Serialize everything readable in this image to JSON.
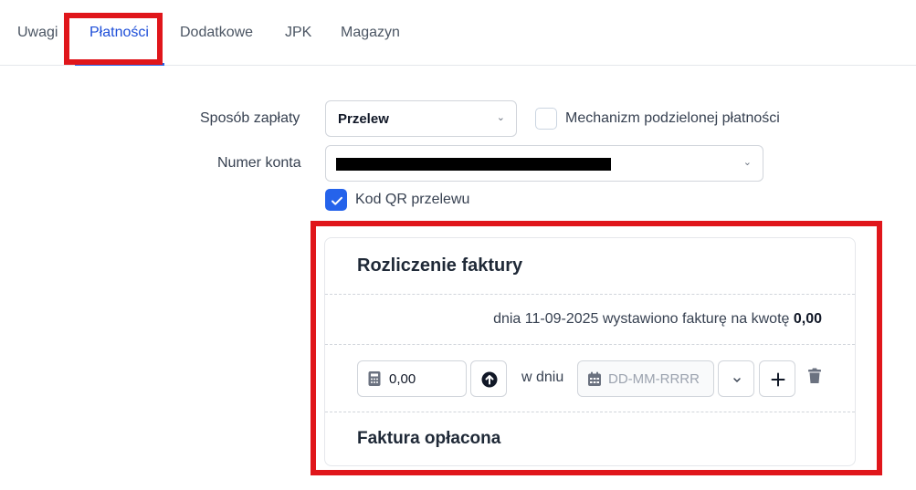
{
  "tabs": [
    {
      "label": "Uwagi"
    },
    {
      "label": "Płatności"
    },
    {
      "label": "Dodatkowe"
    },
    {
      "label": "JPK"
    },
    {
      "label": "Magazyn"
    }
  ],
  "active_tab": "Płatności",
  "form": {
    "payment_method_label": "Sposób zapłaty",
    "payment_method_value": "Przelew",
    "split_payment_label": "Mechanizm podzielonej płatności",
    "split_payment_checked": false,
    "account_number_label": "Numer konta",
    "account_number_value": "[redacted]",
    "qr_label": "Kod QR przelewu",
    "qr_checked": true
  },
  "settlement": {
    "title": "Rozliczenie faktury",
    "info_prefix": "dnia 11-09-2025 wystawiono fakturę na kwotę",
    "info_amount": "0,00",
    "amount_value": "0,00",
    "on_day_label": "w dniu",
    "date_placeholder": "DD-MM-RRRR",
    "paid_label": "Faktura opłacona"
  },
  "colors": {
    "accent": "#2563eb",
    "annotation": "#e0161b"
  },
  "icons": [
    "calculator-icon",
    "arrow-up-circle-icon",
    "calendar-icon",
    "chevron-down-icon",
    "plus-icon",
    "trash-icon",
    "check-icon"
  ]
}
